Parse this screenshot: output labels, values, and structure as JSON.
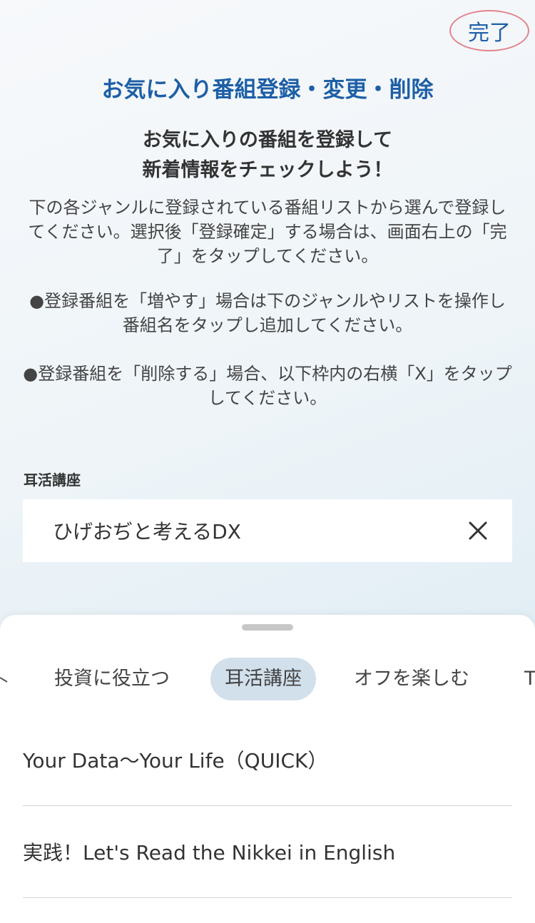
{
  "header": {
    "done_label": "完了",
    "title": "お気に入り番組登録・変更・削除"
  },
  "intro": {
    "headline_line1": "お気に入りの番組を登録して",
    "headline_line2": "新着情報をチェックしよう！",
    "description": [
      "下の各ジャンルに登録されている番組リストから選んで登録してください。選択後「登録確定」する場合は、画面右上の「完了」をタップしてください。",
      "●登録番組を「増やす」場合は下のジャンルやリストを操作し番組名をタップし追加してください。",
      "●登録番組を「削除する」場合、以下枠内の右横「X」をタップしてください。"
    ]
  },
  "favorites": {
    "section_label": "耳活講座",
    "items": [
      {
        "name": "ひげおぢと考えるDX",
        "remove_icon": "close-icon"
      }
    ]
  },
  "genre_sheet": {
    "tabs": [
      {
        "label": "投資に役立つ",
        "active": false
      },
      {
        "label": "耳活講座",
        "active": true
      },
      {
        "label": "オフを楽しむ",
        "active": false
      },
      {
        "label": "T",
        "active": false
      }
    ],
    "programs": [
      {
        "title": "Your Data～Your Life（QUICK）"
      },
      {
        "title": "実践！Let's Read the Nikkei in English"
      }
    ]
  },
  "colors": {
    "accent": "#1d5fa6",
    "highlight_circle": "#e2848c",
    "active_tab_bg": "#d2e0ec"
  }
}
